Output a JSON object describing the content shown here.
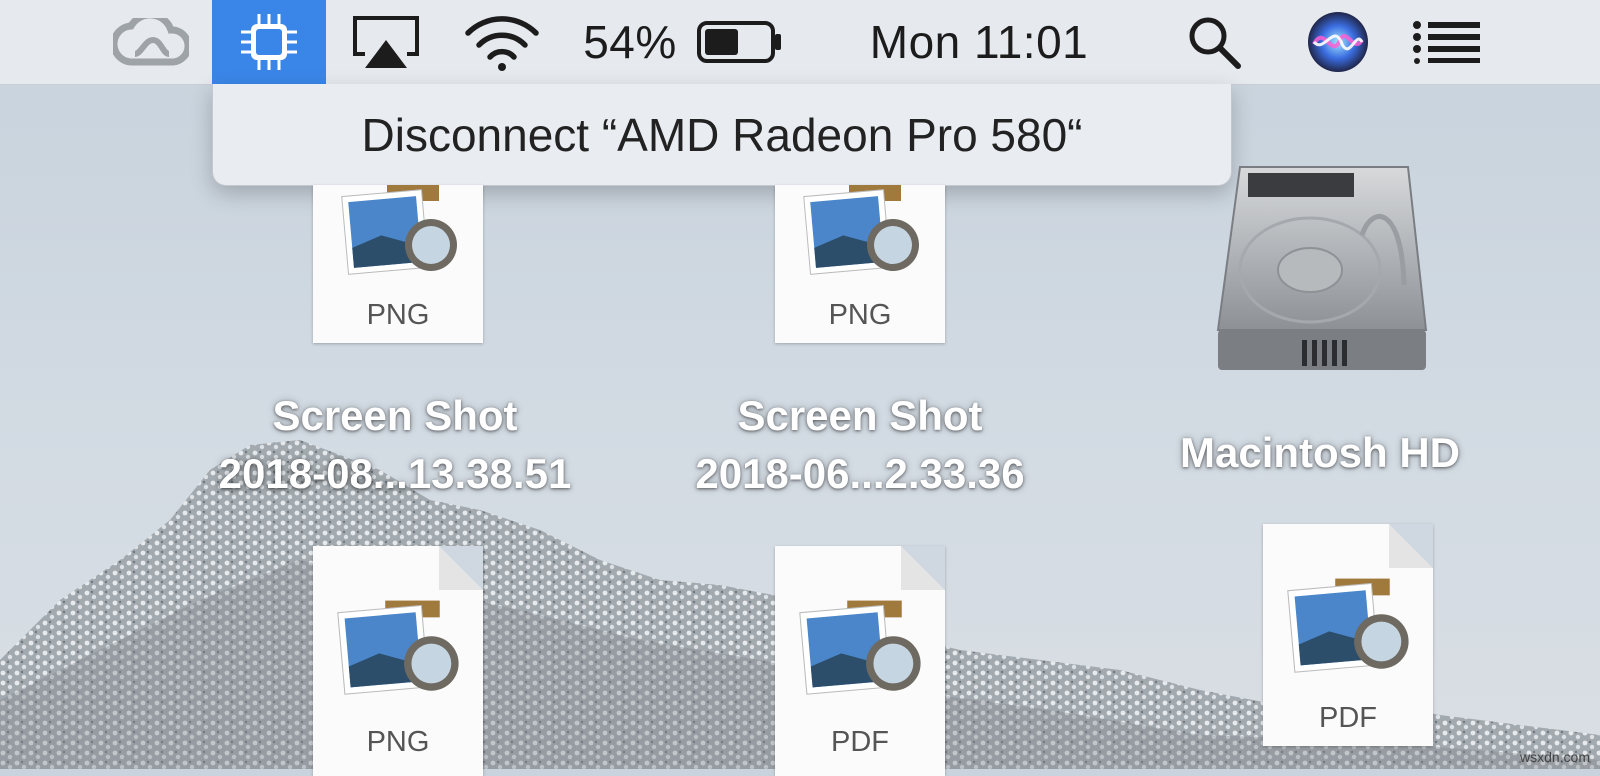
{
  "menubar": {
    "battery_percent": "54%",
    "battery_level": 0.54,
    "clock": "Mon 11:01"
  },
  "popup": {
    "item_label": "Disconnect “AMD Radeon Pro 580“"
  },
  "desktop": {
    "icons": [
      {
        "type": "PNG",
        "name_line1": "Screen Shot",
        "name_line2": "2018-08...13.38.51"
      },
      {
        "type": "PNG",
        "name_line1": "Screen Shot",
        "name_line2": "2018-06...2.33.36"
      },
      {
        "name": "Macintosh HD"
      },
      {
        "type": "PNG"
      },
      {
        "type": "PDF"
      },
      {
        "type": "PDF"
      }
    ]
  },
  "watermark": "wsxdn.com",
  "icons": {
    "creative_cloud": "creative-cloud-icon",
    "gpu": "gpu-chip-icon",
    "airplay": "airplay-icon",
    "wifi": "wifi-icon",
    "battery": "battery-icon",
    "search": "spotlight-search-icon",
    "siri": "siri-icon",
    "notifications": "notification-center-icon"
  },
  "colors": {
    "menubar_highlight": "#3a86e8"
  }
}
